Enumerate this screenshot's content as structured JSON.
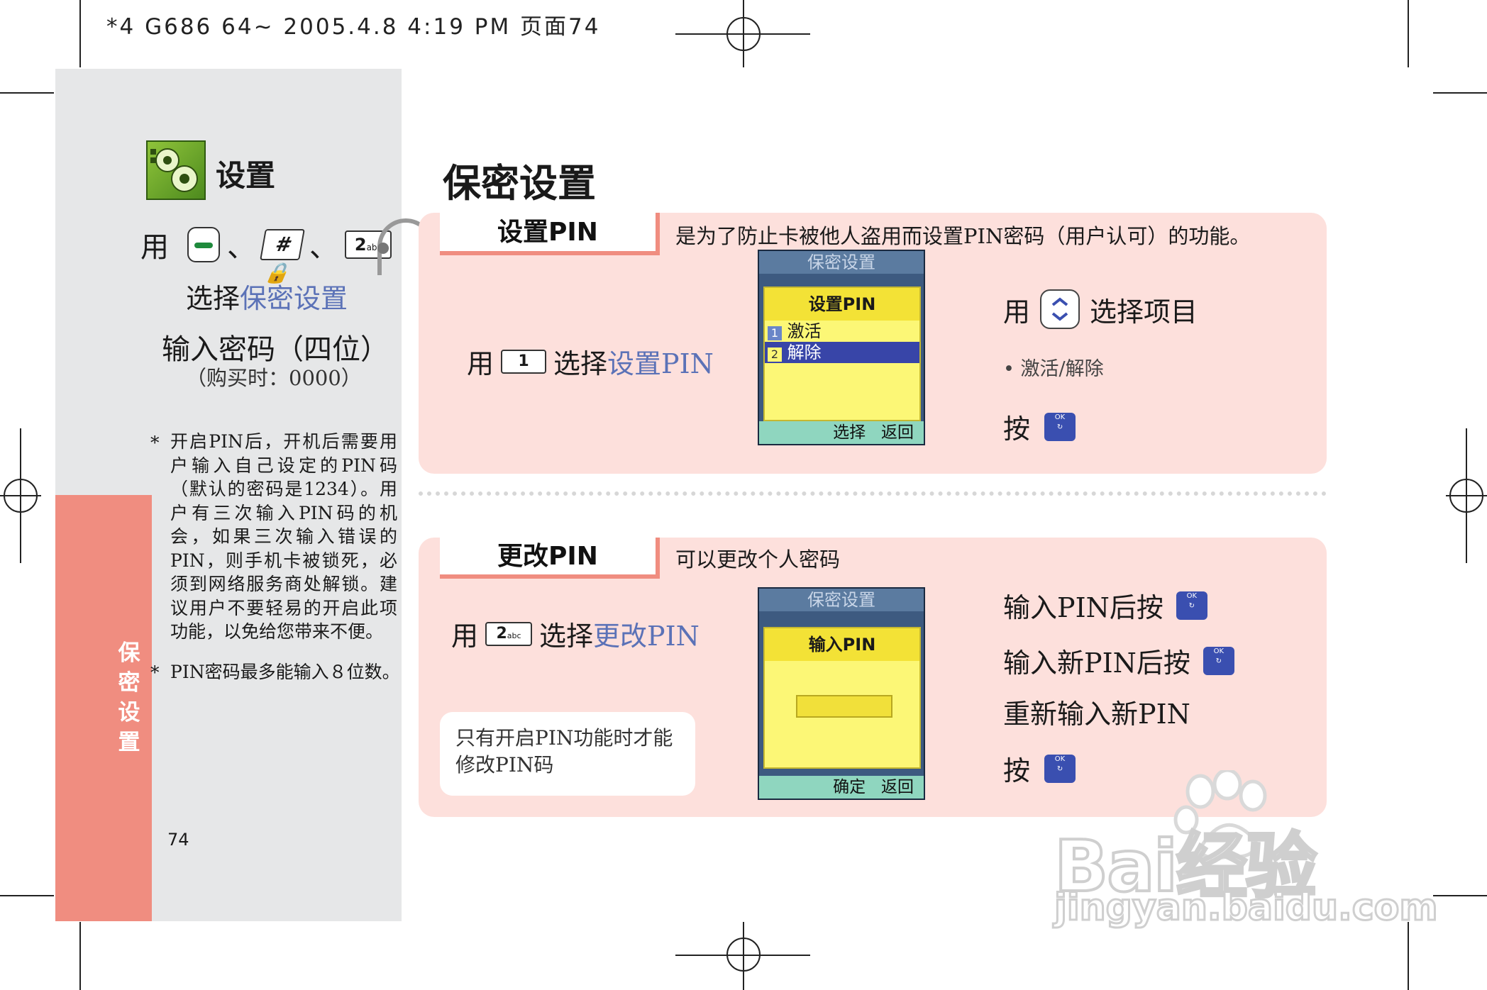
{
  "header": {
    "print_line": "*4 G686 64~  2005.4.8 4:19 PM 页面74"
  },
  "sidebar": {
    "section_title": "设置",
    "nav_prefix": "用",
    "nav_sep": "、",
    "key_hash_label": "#",
    "key_2_label": "2",
    "key_2_sub": "abc",
    "select_prefix": "选择",
    "select_target": "保密设置",
    "enter_password": "输入密码（四位）",
    "default_password": "（购买时：0000）",
    "note_1": "开启PIN后，开机后需要用户输入自己设定的PIN码（默认的密码是1234）。用户有三次输入PIN码的机会，如果三次输入错误的PIN，则手机卡被锁死，必须到网络服务商处解锁。建议用户不要轻易的开启此项功能，以免给您带来不便。",
    "note_2": "PIN密码最多能输入８位数。",
    "bullet": "*",
    "vertical_label": [
      "保",
      "密",
      "设",
      "置"
    ],
    "page_number": "74"
  },
  "main": {
    "page_title": "保密设置",
    "ok_key_label": "OK",
    "section1": {
      "tab_label": "设置PIN",
      "description": "是为了防止卡被他人盗用而设置PIN密码（用户认可）的功能。",
      "step_prefix": "用",
      "step_key": "1",
      "step_select": "选择",
      "step_target": "设置PIN",
      "right_use": "用",
      "right_select": "选择项目",
      "right_bullet": "激活/解除",
      "right_press": "按",
      "phone": {
        "top_title": "保密设置",
        "popup_title": "设置PIN",
        "options": [
          {
            "num": "1",
            "label": "激活"
          },
          {
            "num": "2",
            "label": "解除"
          }
        ],
        "bottom_left": "选择",
        "bottom_right": "返回"
      }
    },
    "section2": {
      "tab_label": "更改PIN",
      "description": "可以更改个人密码",
      "step_prefix": "用",
      "step_key": "2",
      "step_key_sub": "abc",
      "step_select": "选择",
      "step_target": "更改PIN",
      "note": "只有开启PIN功能时才能修改PIN码",
      "right_step1": "输入PIN后按",
      "right_step2": "输入新PIN后按",
      "right_step3": "重新输入新PIN",
      "right_press": "按",
      "phone": {
        "top_title": "保密设置",
        "popup_title": "输入PIN",
        "bottom_left": "确定",
        "bottom_right": "返回"
      }
    }
  },
  "watermark": {
    "brand": "Bai经验",
    "url": "jingyan.baidu.com"
  },
  "colors": {
    "accent_pink": "#f08d80",
    "panel_pink": "#fde0dc",
    "sidebar_grey": "#e6e7e8",
    "link_blue": "#5b72b7",
    "ok_key": "#3a4fb0"
  }
}
